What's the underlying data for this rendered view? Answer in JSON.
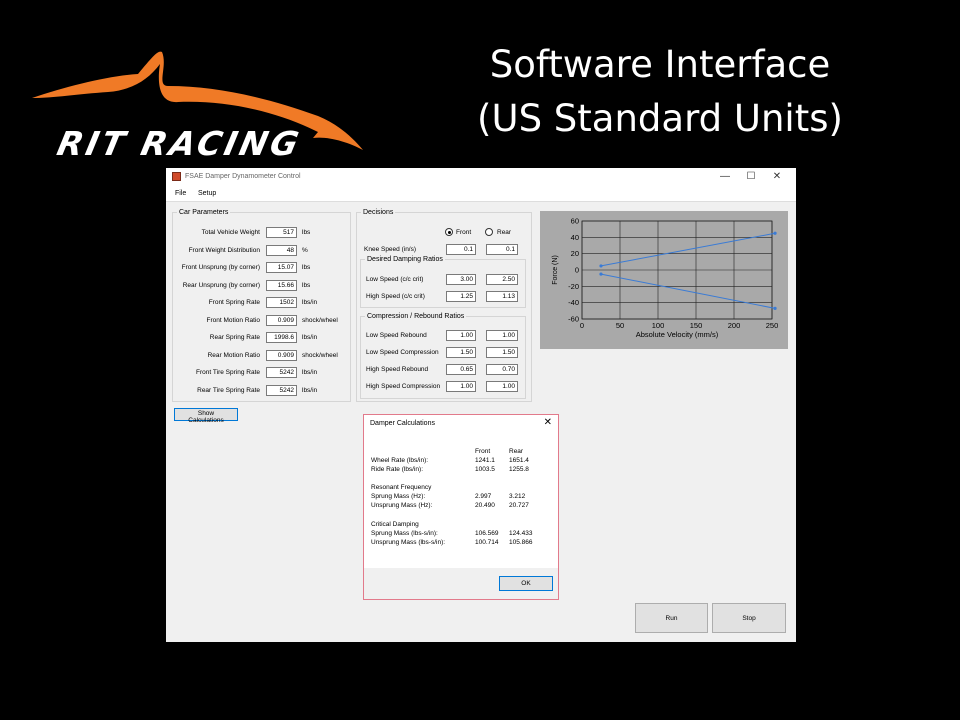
{
  "slide": {
    "title_line1": "Software Interface",
    "title_line2": "(US Standard Units)",
    "logo_text": "RIT RACING",
    "logo_color": "#f07a26"
  },
  "window": {
    "title": "FSAE Damper Dynamometer Control",
    "menu": [
      "File",
      "Setup"
    ],
    "controls": [
      "—",
      "☐",
      "✕"
    ]
  },
  "car_parameters": {
    "title": "Car Parameters",
    "rows": [
      {
        "label": "Total Vehicle Weight",
        "value": "517",
        "unit": "lbs"
      },
      {
        "label": "Front Weight Distribution",
        "value": "48",
        "unit": "%"
      },
      {
        "label": "Front Unsprung (by corner)",
        "value": "15.07",
        "unit": "lbs"
      },
      {
        "label": "Rear Unsprung (by corner)",
        "value": "15.66",
        "unit": "lbs"
      },
      {
        "label": "Front Spring Rate",
        "value": "1502",
        "unit": "lbs/in"
      },
      {
        "label": "Front Motion Ratio",
        "value": "0.909",
        "unit": "shock/wheel"
      },
      {
        "label": "Rear Spring Rate",
        "value": "1998.6",
        "unit": "lbs/in"
      },
      {
        "label": "Rear Motion Ratio",
        "value": "0.909",
        "unit": "shock/wheel"
      },
      {
        "label": "Front Tire Spring Rate",
        "value": "5242",
        "unit": "lbs/in"
      },
      {
        "label": "Rear Tire Spring Rate",
        "value": "5242",
        "unit": "lbs/in"
      }
    ],
    "show_calculations": "Show Calculations"
  },
  "decisions": {
    "title": "Decisions",
    "radio_front": "Front",
    "radio_rear": "Rear",
    "selected": "Front",
    "knee_label": "Knee Speed (in/s)",
    "knee_front": "0.1",
    "knee_rear": "0.1",
    "damping_title": "Desired Damping Ratios",
    "damping_rows": [
      {
        "label": "Low Speed (c/c crit)",
        "front": "3.00",
        "rear": "2.50"
      },
      {
        "label": "High Speed (c/c crit)",
        "front": "1.25",
        "rear": "1.13"
      }
    ],
    "cr_title": "Compression / Rebound Ratios",
    "cr_rows": [
      {
        "label": "Low Speed Rebound",
        "front": "1.00",
        "rear": "1.00"
      },
      {
        "label": "Low Speed Compression",
        "front": "1.50",
        "rear": "1.50"
      },
      {
        "label": "High Speed Rebound",
        "front": "0.65",
        "rear": "0.70"
      },
      {
        "label": "High Speed Compression",
        "front": "1.00",
        "rear": "1.00"
      }
    ]
  },
  "buttons": {
    "run": "Run",
    "stop": "Stop"
  },
  "dialog": {
    "title": "Damper Calculations",
    "close": "✕",
    "col_front": "Front",
    "col_rear": "Rear",
    "rows": [
      {
        "label": "Wheel Rate (lbs/in):",
        "front": "1241.1",
        "rear": "1651.4"
      },
      {
        "label": "Ride Rate (lbs/in):",
        "front": "1003.5",
        "rear": "1255.8"
      },
      {
        "label": "Resonant Frequency",
        "front": "",
        "rear": ""
      },
      {
        "label": "Sprung Mass (Hz):",
        "front": "2.997",
        "rear": "3.212"
      },
      {
        "label": "Unsprung Mass (Hz):",
        "front": "20.490",
        "rear": "20.727"
      },
      {
        "label": "Critical Damping",
        "front": "",
        "rear": ""
      },
      {
        "label": "Sprung Mass (lbs-s/in):",
        "front": "106.569",
        "rear": "124.433"
      },
      {
        "label": "Unsprung Mass (lbs-s/in):",
        "front": "100.714",
        "rear": "105.866"
      }
    ],
    "ok": "OK"
  },
  "chart_data": {
    "type": "line",
    "title": "",
    "xlabel": "Absolute Velocity (mm/s)",
    "ylabel": "Force (N)",
    "xlim": [
      0,
      250
    ],
    "ylim": [
      -60,
      60
    ],
    "xticks": [
      0,
      50,
      100,
      150,
      200,
      250
    ],
    "yticks": [
      60,
      40,
      20,
      0,
      -20,
      -40,
      -60
    ],
    "grid": true,
    "series": [
      {
        "x": [
          25,
          254
        ],
        "y": [
          5,
          45
        ],
        "color": "#3a7bd5"
      },
      {
        "x": [
          25,
          254
        ],
        "y": [
          -5,
          -47
        ],
        "color": "#3a7bd5"
      }
    ]
  }
}
